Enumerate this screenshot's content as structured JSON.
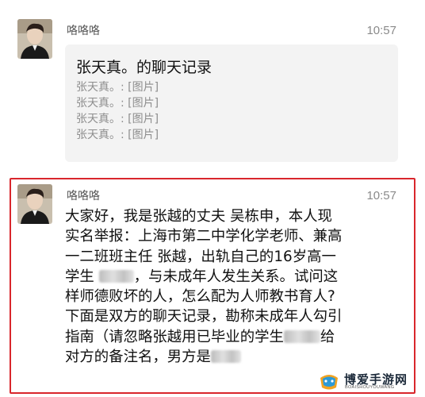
{
  "messages": [
    {
      "sender": "咯咯咯",
      "time": "10:57",
      "card": {
        "title": "张天真。的聊天记录",
        "lines": [
          "张天真。: [图片]",
          "张天真。: [图片]",
          "张天真。: [图片]",
          "张天真。: [图片]"
        ]
      }
    },
    {
      "sender": "咯咯咯",
      "time": "10:57",
      "lines": {
        "l1": "大家好，我是张越的丈夫 吴栋申，本人现",
        "l2": "实名举报：上海市第二中学化学老师、兼高",
        "l3": "一二班班主任 张越，出轨自己的16岁高一",
        "l4a": "学生 ",
        "l4b": "，与未成年人发生关系。试问这",
        "l5": "样师德败坏的人，怎么配为人师教书育人?",
        "l6": "下面是双方的聊天记录，勘称未成年人勾引",
        "l7a": "指南（请忽略张越用已毕业的学生",
        "l7b": "给",
        "l8a": "对方的备注名，男方是",
        "l8b": ""
      }
    }
  ],
  "watermark": {
    "title": "博爱手游网",
    "subtitle": "BOAISHOUYOUWANG"
  }
}
